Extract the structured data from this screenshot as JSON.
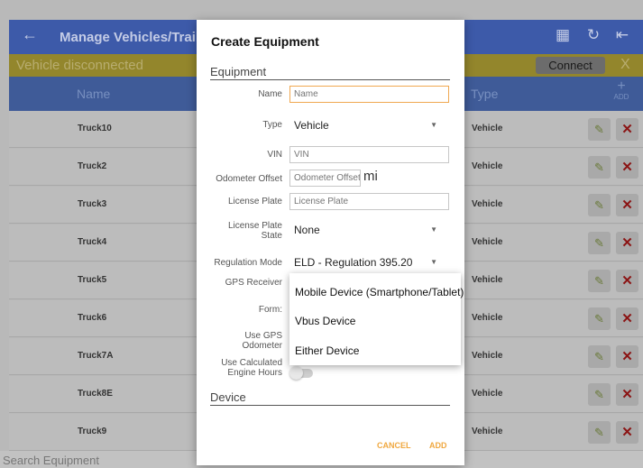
{
  "appbar": {
    "back_icon": "arrow-left-icon",
    "title": "Manage Vehicles/Trailer",
    "icons": [
      "device-export-icon",
      "refresh-icon",
      "logout-icon"
    ]
  },
  "status": {
    "message": "Vehicle disconnected",
    "connect_label": "Connect",
    "dismiss_label": "X",
    "color": "#93862c"
  },
  "table": {
    "headers": {
      "name": "Name",
      "type": "Type",
      "add": "ADD"
    },
    "rows": [
      {
        "name": "Truck10",
        "type": "Vehicle"
      },
      {
        "name": "Truck2",
        "type": "Vehicle"
      },
      {
        "name": "Truck3",
        "type": "Vehicle"
      },
      {
        "name": "Truck4",
        "type": "Vehicle"
      },
      {
        "name": "Truck5",
        "type": "Vehicle"
      },
      {
        "name": "Truck6",
        "type": "Vehicle"
      },
      {
        "name": "Truck7A",
        "type": "Vehicle"
      },
      {
        "name": "Truck8E",
        "type": "Vehicle"
      },
      {
        "name": "Truck9",
        "type": "Vehicle"
      }
    ]
  },
  "search": {
    "placeholder": "Search Equipment"
  },
  "dialog": {
    "title": "Create Equipment",
    "section_equipment": "Equipment",
    "section_device": "Device",
    "fields": {
      "name": {
        "label": "Name",
        "placeholder": "Name"
      },
      "type": {
        "label": "Type",
        "value": "Vehicle"
      },
      "vin": {
        "label": "VIN",
        "placeholder": "VIN"
      },
      "odometer": {
        "label": "Odometer Offset",
        "placeholder": "Odometer Offset",
        "unit": "mi"
      },
      "plate": {
        "label": "License Plate",
        "placeholder": "License Plate"
      },
      "plate_state": {
        "label": "License Plate State",
        "value": "None"
      },
      "regulation": {
        "label": "Regulation Mode",
        "value": "ELD - Regulation 395.20"
      },
      "gps": {
        "label": "GPS Receiver"
      },
      "form": {
        "label": "Form:"
      },
      "use_gps_odometer": {
        "label": "Use GPS Odometer"
      },
      "use_calc_hours": {
        "label": "Use Calculated Engine Hours"
      }
    },
    "dropdown_options": [
      "Mobile Device (Smartphone/Tablet)",
      "Vbus Device",
      "Either Device"
    ],
    "cancel_label": "CANCEL",
    "add_label": "ADD",
    "accent": "#f0a840"
  }
}
